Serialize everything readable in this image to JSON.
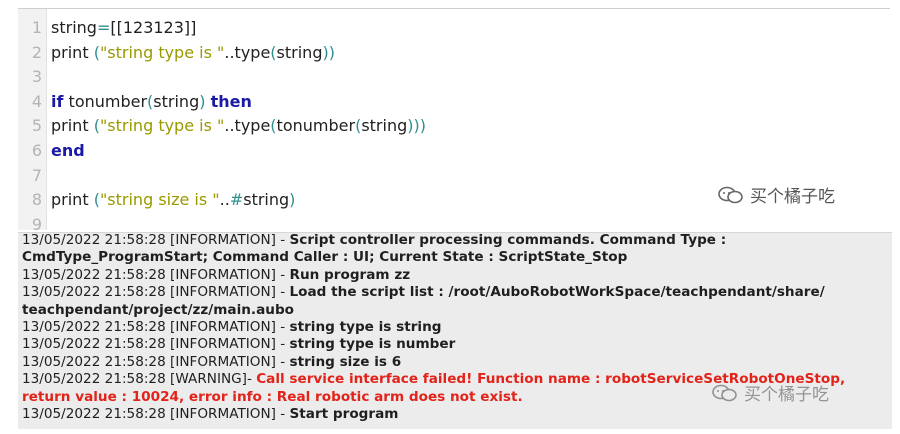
{
  "editor": {
    "lines": [
      {
        "n": "1",
        "tokens": [
          {
            "t": "string",
            "c": ""
          },
          {
            "t": "=",
            "c": "op"
          },
          {
            "t": "[[123123]]",
            "c": ""
          }
        ]
      },
      {
        "n": "2",
        "tokens": [
          {
            "t": "print ",
            "c": ""
          },
          {
            "t": "(",
            "c": "paren"
          },
          {
            "t": "\"string type is \"",
            "c": "str"
          },
          {
            "t": "..type",
            "c": ""
          },
          {
            "t": "(",
            "c": "paren"
          },
          {
            "t": "string",
            "c": ""
          },
          {
            "t": "))",
            "c": "paren"
          }
        ]
      },
      {
        "n": "3",
        "tokens": []
      },
      {
        "n": "4",
        "tokens": [
          {
            "t": "if",
            "c": "kw"
          },
          {
            "t": " tonumber",
            "c": ""
          },
          {
            "t": "(",
            "c": "paren"
          },
          {
            "t": "string",
            "c": ""
          },
          {
            "t": ")",
            "c": "paren"
          },
          {
            "t": " ",
            "c": ""
          },
          {
            "t": "then",
            "c": "kw"
          }
        ]
      },
      {
        "n": "5",
        "tokens": [
          {
            "t": "print ",
            "c": ""
          },
          {
            "t": "(",
            "c": "paren"
          },
          {
            "t": "\"string type is \"",
            "c": "str"
          },
          {
            "t": "..type",
            "c": ""
          },
          {
            "t": "(",
            "c": "paren"
          },
          {
            "t": "tonumber",
            "c": ""
          },
          {
            "t": "(",
            "c": "paren"
          },
          {
            "t": "string",
            "c": ""
          },
          {
            "t": ")))",
            "c": "paren"
          }
        ]
      },
      {
        "n": "6",
        "tokens": [
          {
            "t": "end",
            "c": "kw"
          }
        ]
      },
      {
        "n": "7",
        "tokens": []
      },
      {
        "n": "8",
        "tokens": [
          {
            "t": "print ",
            "c": ""
          },
          {
            "t": "(",
            "c": "paren"
          },
          {
            "t": "\"string size is \"",
            "c": "str"
          },
          {
            "t": "..",
            "c": ""
          },
          {
            "t": "#",
            "c": "op"
          },
          {
            "t": "string",
            "c": ""
          },
          {
            "t": ")",
            "c": "paren"
          }
        ]
      },
      {
        "n": "9",
        "tokens": []
      }
    ]
  },
  "watermark": {
    "text": "买个橘子吃",
    "icon": "wechat-channel-icon"
  },
  "console": {
    "rows": [
      {
        "stamp": "13/05/2022 21:58:28 [INFORMATION] - ",
        "msg": "Script controller processing commands. Command Type :",
        "level": "info"
      },
      {
        "stamp": "",
        "msg": "CmdType_ProgramStart; Command Caller : UI; Current State : ScriptState_Stop",
        "level": "info"
      },
      {
        "stamp": "13/05/2022 21:58:28 [INFORMATION] - ",
        "msg": "Run program zz",
        "level": "info"
      },
      {
        "stamp": "13/05/2022 21:58:28 [INFORMATION] - ",
        "msg": "Load the script list : /root/AuboRobotWorkSpace/teachpendant/share/",
        "level": "info"
      },
      {
        "stamp": "",
        "msg": "teachpendant/project/zz/main.aubo",
        "level": "info"
      },
      {
        "stamp": "13/05/2022 21:58:28 [INFORMATION] - ",
        "msg": "string type is string",
        "level": "info"
      },
      {
        "stamp": "13/05/2022 21:58:28 [INFORMATION] - ",
        "msg": "string type is number",
        "level": "info"
      },
      {
        "stamp": "13/05/2022 21:58:28 [INFORMATION] - ",
        "msg": "string size is 6",
        "level": "info"
      },
      {
        "stamp": "13/05/2022 21:58:28 [WARNING]- ",
        "msg": "Call service interface failed! Function name : robotServiceSetRobotOneStop,",
        "level": "warning"
      },
      {
        "stamp": "",
        "msg": "return value : 10024, error info : Real robotic arm does not exist.",
        "level": "warning"
      },
      {
        "stamp": "13/05/2022 21:58:28 [INFORMATION] - ",
        "msg": "Start program",
        "level": "info"
      }
    ]
  },
  "colors": {
    "keyword": "#1a1aa6",
    "string": "#999900",
    "paren": "#2f8f8f",
    "warning": "#e2231a",
    "console_bg": "#ececec"
  }
}
